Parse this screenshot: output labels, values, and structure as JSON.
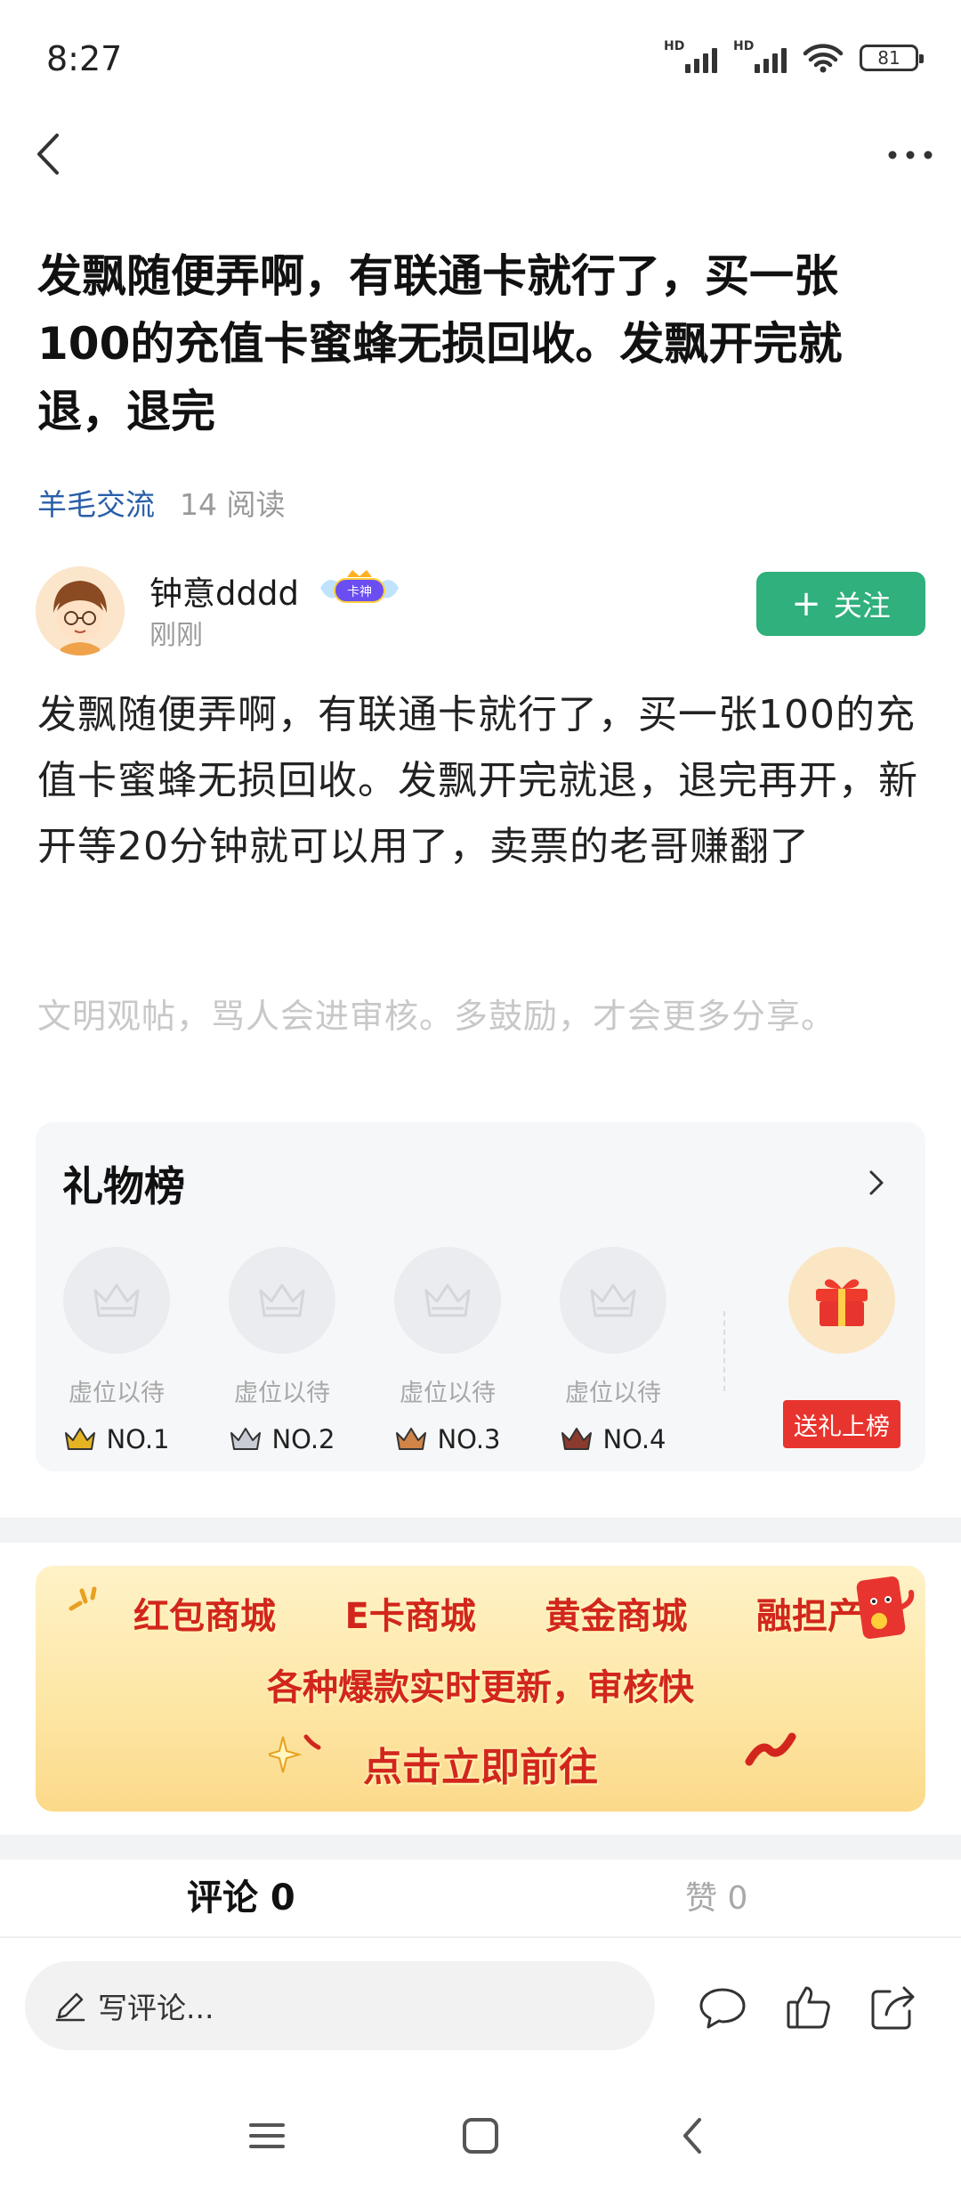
{
  "status_bar": {
    "time": "8:27",
    "signal1_label": "HD",
    "signal2_label": "HD",
    "battery": "81"
  },
  "nav": {
    "back_icon": "chevron-left-icon",
    "more_icon": "more-dots-icon"
  },
  "post": {
    "title": "发飘随便弄啊，有联通卡就行了，买一张100的充值卡蜜蜂无损回收。发飘开完就退，退完",
    "category": "羊毛交流",
    "reads": "14 阅读",
    "author": {
      "name": "钟意dddd",
      "badge": "卡神",
      "time": "刚刚",
      "follow_label": "关注"
    },
    "body": "发飘随便弄啊，有联通卡就行了，买一张100的充值卡蜜蜂无损回收。发飘开完就退，退完再开，新开等20分钟就可以用了，卖票的老哥赚翻了",
    "notice": "文明观帖，骂人会进审核。多鼓励，才会更多分享。"
  },
  "gift_board": {
    "title": "礼物榜",
    "slots": [
      {
        "label": "虚位以待",
        "rank": "NO.1",
        "crown_color": "#e6b422"
      },
      {
        "label": "虚位以待",
        "rank": "NO.2",
        "crown_color": "#8a8f98"
      },
      {
        "label": "虚位以待",
        "rank": "NO.3",
        "crown_color": "#c0703a"
      },
      {
        "label": "虚位以待",
        "rank": "NO.4",
        "crown_color": "#7a3b2e"
      }
    ],
    "send_label": "送礼上榜"
  },
  "banner": {
    "row1": [
      "红包商城",
      "E卡商城",
      "黄金商城",
      "融担产品"
    ],
    "row2": "各种爆款实时更新，审核快",
    "row3": "点击立即前往"
  },
  "tabs": {
    "comments": "评论 0",
    "likes": "赞 0"
  },
  "actions": {
    "comment_placeholder": "写评论..."
  },
  "colors": {
    "accent_green": "#2fb07c",
    "link_blue": "#2a5ea8",
    "gift_red": "#e8342e",
    "banner_red": "#d2261c"
  }
}
